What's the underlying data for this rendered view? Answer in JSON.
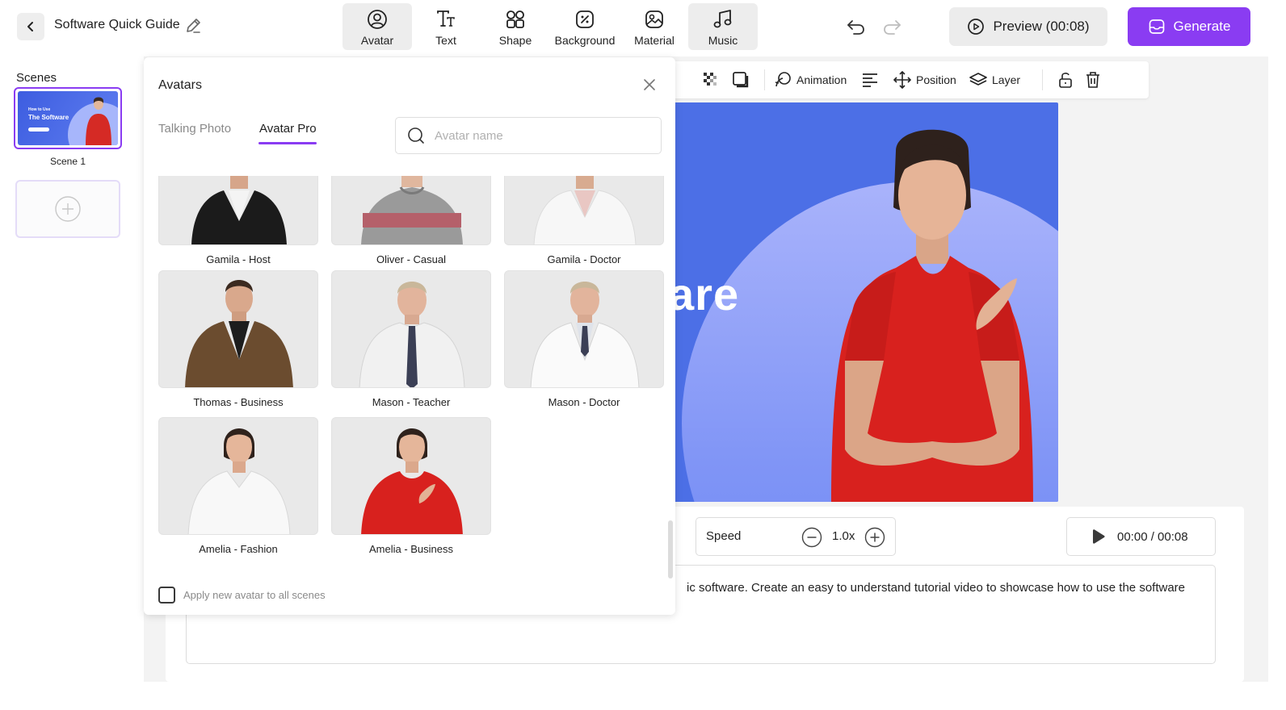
{
  "header": {
    "project_title": "Software Quick Guide",
    "tools": [
      {
        "label": "Avatar",
        "icon": "avatar-icon",
        "active": true
      },
      {
        "label": "Text",
        "icon": "text-icon",
        "active": false
      },
      {
        "label": "Shape",
        "icon": "shape-icon",
        "active": false
      },
      {
        "label": "Background",
        "icon": "background-icon",
        "active": false
      },
      {
        "label": "Material",
        "icon": "material-icon",
        "active": false
      },
      {
        "label": "Music",
        "icon": "music-icon",
        "active": true
      }
    ],
    "preview_label": "Preview (00:08)",
    "generate_label": "Generate",
    "accent_color": "#8a3cf2"
  },
  "scenes": {
    "title": "Scenes",
    "items": [
      {
        "label": "Scene 1",
        "thumb_line1": "How to Use",
        "thumb_line2": "The Software"
      }
    ]
  },
  "canvas_toolbar": {
    "animation_label": "Animation",
    "position_label": "Position",
    "layer_label": "Layer"
  },
  "stage": {
    "visible_text": "are",
    "background_color": "#4c6fe6"
  },
  "controls": {
    "speed_label": "Speed",
    "speed_value": "1.0x",
    "time": "00:00 / 00:08",
    "script_text": "ic software. Create an easy to understand tutorial video to showcase how to use the software"
  },
  "avatars_panel": {
    "title": "Avatars",
    "tabs": [
      {
        "label": "Talking Photo",
        "active": false
      },
      {
        "label": "Avatar Pro",
        "active": true
      }
    ],
    "search_placeholder": "Avatar name",
    "avatars": [
      {
        "name": "Gamila - Host"
      },
      {
        "name": "Oliver - Casual"
      },
      {
        "name": "Gamila - Doctor"
      },
      {
        "name": "Thomas - Business"
      },
      {
        "name": "Mason - Teacher"
      },
      {
        "name": "Mason - Doctor"
      },
      {
        "name": "Amelia - Fashion"
      },
      {
        "name": "Amelia - Business"
      }
    ],
    "apply_all_label": "Apply new avatar to all scenes",
    "apply_all_checked": false
  }
}
